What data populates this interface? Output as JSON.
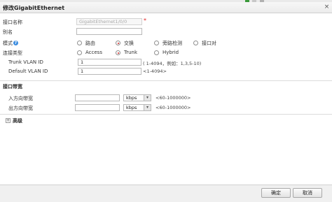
{
  "window": {
    "title": "修改GigabitEthernet",
    "close_glyph": "×"
  },
  "form": {
    "interface_name": {
      "label": "接口名称",
      "value": "GigabitEthernet1/0/0",
      "required_mark": "*"
    },
    "alias": {
      "label": "别名",
      "value": ""
    },
    "mode": {
      "label": "模式",
      "help_glyph": "?",
      "options": [
        "路由",
        "交换",
        "旁路检测",
        "接口对"
      ],
      "selected": "交换"
    },
    "link_type": {
      "label": "连接类型",
      "options": [
        "Access",
        "Trunk",
        "Hybrid"
      ],
      "selected": "Trunk"
    },
    "trunk_vlan_id": {
      "label": "Trunk VLAN ID",
      "value": "1",
      "hint": "( 1-4094，例如：1,3,5-10)"
    },
    "default_vlan_id": {
      "label": "Default VLAN ID",
      "value": "1",
      "hint": "<1-4094>"
    }
  },
  "bandwidth": {
    "section_title": "接口带宽",
    "inbound": {
      "label": "入方向带宽",
      "value": "",
      "unit": "kbps",
      "hint": "<60-1000000>"
    },
    "outbound": {
      "label": "出方向带宽",
      "value": "",
      "unit": "kbps",
      "hint": "<60-1000000>"
    }
  },
  "advanced": {
    "label": "高级",
    "expander_glyph": "+"
  },
  "footer": {
    "ok_label": "确定",
    "cancel_label": "取消"
  },
  "colors": {
    "radio_selected": "#d42323",
    "help_icon": "#3c8de0",
    "required": "#e02020"
  }
}
